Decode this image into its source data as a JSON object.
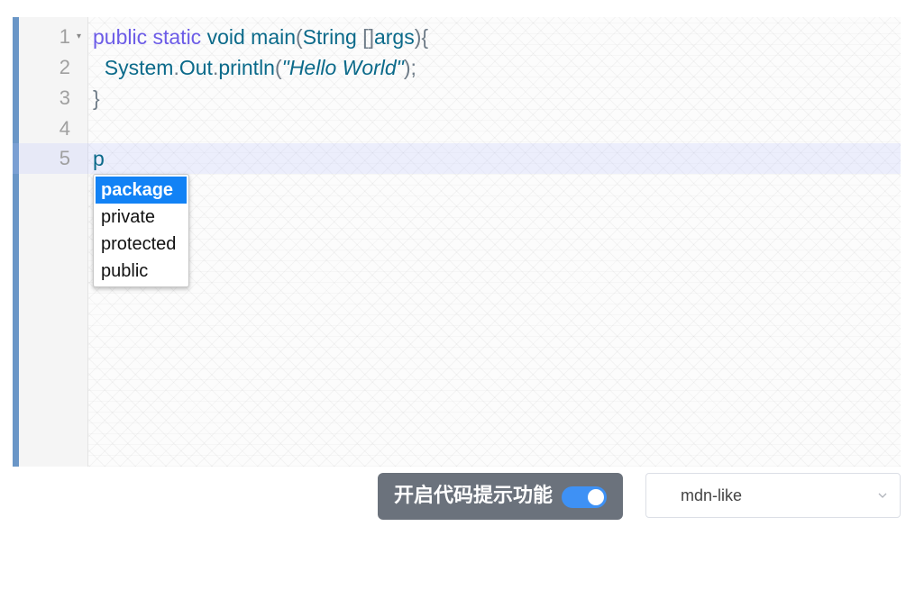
{
  "editor": {
    "lines": [
      {
        "number": "1",
        "fold": "▾",
        "tokens": [
          {
            "text": "public",
            "cls": "kw"
          },
          {
            "text": " ",
            "cls": "plain"
          },
          {
            "text": "static",
            "cls": "kw"
          },
          {
            "text": " ",
            "cls": "plain"
          },
          {
            "text": "void",
            "cls": "fn"
          },
          {
            "text": " ",
            "cls": "plain"
          },
          {
            "text": "main",
            "cls": "fn"
          },
          {
            "text": "(",
            "cls": "br"
          },
          {
            "text": "String",
            "cls": "fn"
          },
          {
            "text": " ",
            "cls": "plain"
          },
          {
            "text": "[]",
            "cls": "br"
          },
          {
            "text": "args",
            "cls": "fn"
          },
          {
            "text": "){",
            "cls": "br"
          }
        ]
      },
      {
        "number": "2",
        "fold": "",
        "tokens": [
          {
            "text": "  System",
            "cls": "fn"
          },
          {
            "text": ".",
            "cls": "br"
          },
          {
            "text": "Out",
            "cls": "fn"
          },
          {
            "text": ".",
            "cls": "br"
          },
          {
            "text": "println",
            "cls": "fn"
          },
          {
            "text": "(",
            "cls": "br"
          },
          {
            "text": "\"Hello World\"",
            "cls": "str"
          },
          {
            "text": ");",
            "cls": "br"
          }
        ]
      },
      {
        "number": "3",
        "fold": "",
        "tokens": [
          {
            "text": "}",
            "cls": "br"
          }
        ]
      },
      {
        "number": "4",
        "fold": "",
        "tokens": []
      },
      {
        "number": "5",
        "fold": "",
        "active": true,
        "tokens": [
          {
            "text": "p",
            "cls": "fn"
          }
        ]
      }
    ]
  },
  "autocomplete": {
    "items": [
      {
        "label": "package",
        "selected": true
      },
      {
        "label": "private",
        "selected": false
      },
      {
        "label": "protected",
        "selected": false
      },
      {
        "label": "public",
        "selected": false
      }
    ]
  },
  "controls": {
    "hint_toggle_label": "开启代码提示功能",
    "hint_toggle_on": true,
    "theme_select_value": "mdn-like"
  },
  "colors": {
    "toggle_bg": "#6b727c",
    "switch_on": "#3e91f5",
    "ac_selected": "#1282f5",
    "editor_border": "#6a96c7"
  }
}
